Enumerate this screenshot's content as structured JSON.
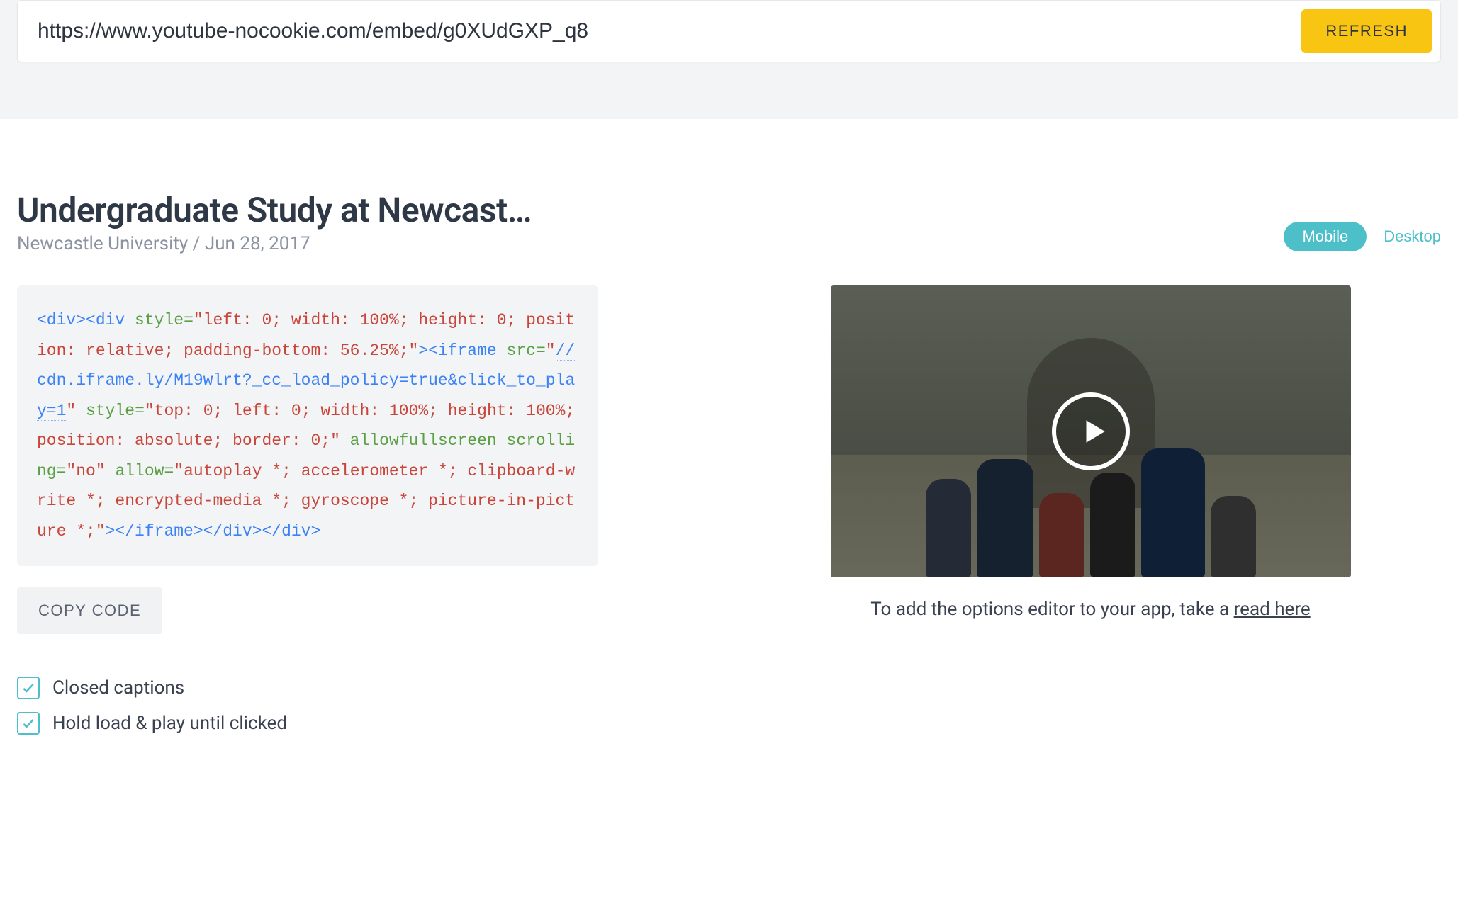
{
  "urlbar": {
    "value": "https://www.youtube-nocookie.com/embed/g0XUdGXP_q8",
    "refresh": "REFRESH"
  },
  "heading": {
    "title": "Undergraduate Study at Newcast…",
    "subtitle": "Newcastle University / Jun 28, 2017"
  },
  "viewToggle": {
    "mobile": "Mobile",
    "desktop": "Desktop"
  },
  "code": {
    "t1": "<div><div",
    "a1": " style",
    "e1": "=",
    "s1": "\"left: 0; width: 100%; height: 0; position: relative; padding-bottom: 56.25%;\"",
    "t2": "><iframe",
    "a2": " src",
    "e2": "=",
    "sq1": "\"",
    "link": "//cdn.iframe.ly/M19wlrt?_cc_load_policy=true&click_to_play=1",
    "sq2": "\"",
    "a3": " style",
    "e3": "=",
    "s3": "\"top: 0; left: 0; width: 100%; height: 100%; position: absolute; border: 0;\"",
    "a4": " allowfullscreen scrolling",
    "e4": "=",
    "s4": "\"no\"",
    "a5": " allow",
    "e5": "=",
    "s5": "\"autoplay *; accelerometer *; clipboard-write *; encrypted-media *; gyroscope *; picture-in-picture *;\"",
    "t3": "></iframe></div></div>"
  },
  "copy": "COPY CODE",
  "options": {
    "cc": "Closed captions",
    "hold": "Hold load & play until clicked"
  },
  "preview": {
    "caption_pre": "To add the options editor to your app, take a ",
    "caption_link": "read here"
  }
}
